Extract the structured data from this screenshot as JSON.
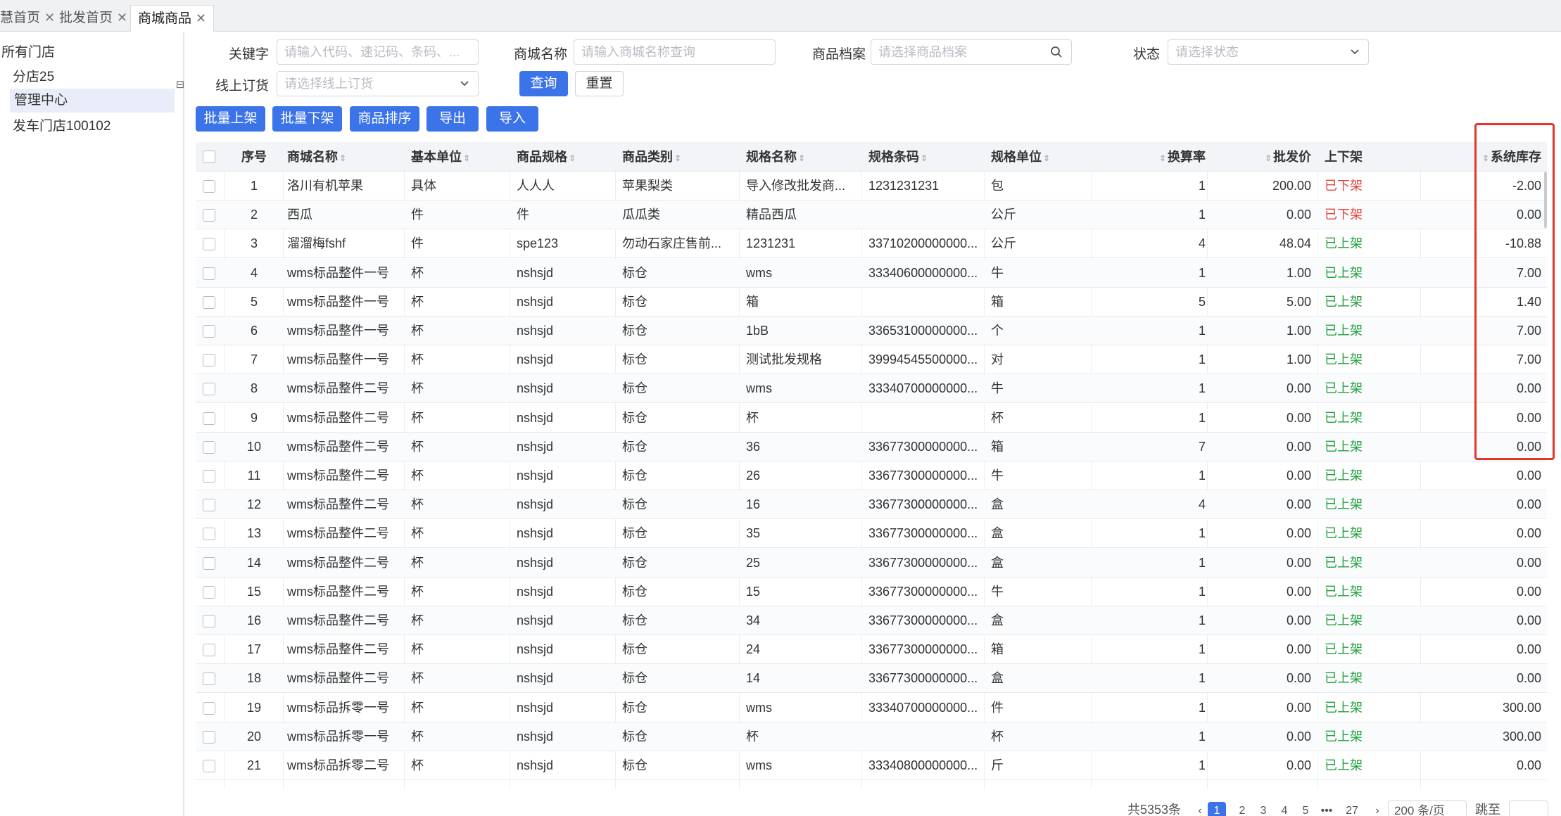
{
  "tabs": [
    {
      "label": "慧首页",
      "active": false
    },
    {
      "label": "批发首页",
      "active": false
    },
    {
      "label": "商城商品",
      "active": true
    }
  ],
  "sidebar": {
    "collapse_glyph": "⊟",
    "items": [
      {
        "label": "所有门店",
        "selected": false
      },
      {
        "label": "分店25",
        "selected": false
      },
      {
        "label": "管理中心",
        "selected": true
      },
      {
        "label": "发车门店100102",
        "selected": false
      }
    ]
  },
  "filters": {
    "keyword": {
      "label": "关键字",
      "placeholder": "请输入代码、速记码、条码、..."
    },
    "mall_name": {
      "label": "商城名称",
      "placeholder": "请输入商城名称查询"
    },
    "archive": {
      "label": "商品档案",
      "placeholder": "请选择商品档案"
    },
    "status": {
      "label": "状态",
      "placeholder": "请选择状态"
    },
    "online_order": {
      "label": "线上订货",
      "placeholder": "请选择线上订货"
    },
    "query_label": "查询",
    "reset_label": "重置"
  },
  "toolbar": {
    "batch_on": "批量上架",
    "batch_off": "批量下架",
    "sort": "商品排序",
    "export": "导出",
    "import": "导入"
  },
  "table": {
    "columns": [
      "序号",
      "商城名称",
      "基本单位",
      "商品规格",
      "商品类别",
      "规格名称",
      "规格条码",
      "规格单位",
      "换算率",
      "批发价",
      "上下架",
      "系统库存"
    ],
    "rows": [
      [
        "1",
        "洛川有机苹果",
        "具体",
        "人人人",
        "苹果梨类",
        "导入修改批发商...",
        "1231231231",
        "包",
        "1",
        "200.00",
        "已下架",
        "-2.00"
      ],
      [
        "2",
        "西瓜",
        "件",
        "件",
        "瓜瓜类",
        "精品西瓜",
        "",
        "公斤",
        "1",
        "0.00",
        "已下架",
        "0.00"
      ],
      [
        "3",
        "溜溜梅fshf",
        "件",
        "spe123",
        "勿动石家庄售前...",
        "1231231",
        "33710200000000...",
        "公斤",
        "4",
        "48.04",
        "已上架",
        "-10.88"
      ],
      [
        "4",
        "wms标品整件一号",
        "杯",
        "nshsjd",
        "标仓",
        "wms",
        "33340600000000...",
        "牛",
        "1",
        "1.00",
        "已上架",
        "7.00"
      ],
      [
        "5",
        "wms标品整件一号",
        "杯",
        "nshsjd",
        "标仓",
        "箱",
        "",
        "箱",
        "5",
        "5.00",
        "已上架",
        "1.40"
      ],
      [
        "6",
        "wms标品整件一号",
        "杯",
        "nshsjd",
        "标仓",
        "1bB",
        "33653100000000...",
        "个",
        "1",
        "1.00",
        "已上架",
        "7.00"
      ],
      [
        "7",
        "wms标品整件一号",
        "杯",
        "nshsjd",
        "标仓",
        "测试批发规格",
        "39994545500000...",
        "对",
        "1",
        "1.00",
        "已上架",
        "7.00"
      ],
      [
        "8",
        "wms标品整件二号",
        "杯",
        "nshsjd",
        "标仓",
        "wms",
        "33340700000000...",
        "牛",
        "1",
        "0.00",
        "已上架",
        "0.00"
      ],
      [
        "9",
        "wms标品整件二号",
        "杯",
        "nshsjd",
        "标仓",
        "杯",
        "",
        "杯",
        "1",
        "0.00",
        "已上架",
        "0.00"
      ],
      [
        "10",
        "wms标品整件二号",
        "杯",
        "nshsjd",
        "标仓",
        "36",
        "33677300000000...",
        "箱",
        "7",
        "0.00",
        "已上架",
        "0.00"
      ],
      [
        "11",
        "wms标品整件二号",
        "杯",
        "nshsjd",
        "标仓",
        "26",
        "33677300000000...",
        "牛",
        "1",
        "0.00",
        "已上架",
        "0.00"
      ],
      [
        "12",
        "wms标品整件二号",
        "杯",
        "nshsjd",
        "标仓",
        "16",
        "33677300000000...",
        "盒",
        "4",
        "0.00",
        "已上架",
        "0.00"
      ],
      [
        "13",
        "wms标品整件二号",
        "杯",
        "nshsjd",
        "标仓",
        "35",
        "33677300000000...",
        "盒",
        "1",
        "0.00",
        "已上架",
        "0.00"
      ],
      [
        "14",
        "wms标品整件二号",
        "杯",
        "nshsjd",
        "标仓",
        "25",
        "33677300000000...",
        "盒",
        "1",
        "0.00",
        "已上架",
        "0.00"
      ],
      [
        "15",
        "wms标品整件二号",
        "杯",
        "nshsjd",
        "标仓",
        "15",
        "33677300000000...",
        "牛",
        "1",
        "0.00",
        "已上架",
        "0.00"
      ],
      [
        "16",
        "wms标品整件二号",
        "杯",
        "nshsjd",
        "标仓",
        "34",
        "33677300000000...",
        "盒",
        "1",
        "0.00",
        "已上架",
        "0.00"
      ],
      [
        "17",
        "wms标品整件二号",
        "杯",
        "nshsjd",
        "标仓",
        "24",
        "33677300000000...",
        "箱",
        "1",
        "0.00",
        "已上架",
        "0.00"
      ],
      [
        "18",
        "wms标品整件二号",
        "杯",
        "nshsjd",
        "标仓",
        "14",
        "33677300000000...",
        "盒",
        "1",
        "0.00",
        "已上架",
        "0.00"
      ],
      [
        "19",
        "wms标品拆零一号",
        "杯",
        "nshsjd",
        "标仓",
        "wms",
        "33340700000000...",
        "件",
        "1",
        "0.00",
        "已上架",
        "300.00"
      ],
      [
        "20",
        "wms标品拆零一号",
        "杯",
        "nshsjd",
        "标仓",
        "杯",
        "",
        "杯",
        "1",
        "0.00",
        "已上架",
        "300.00"
      ],
      [
        "21",
        "wms标品拆零二号",
        "杯",
        "nshsjd",
        "标仓",
        "wms",
        "33340800000000...",
        "斤",
        "1",
        "0.00",
        "已上架",
        "0.00"
      ]
    ]
  },
  "pagination": {
    "total": "共5353条",
    "prev": "‹",
    "pages": [
      "1",
      "2",
      "3",
      "4",
      "5",
      "•••",
      "27"
    ],
    "current": "1",
    "next": "›",
    "page_size": "200 条/页",
    "jump_label": "跳至"
  },
  "colors": {
    "primary": "#3b73e8",
    "off_shelf": "#e2443a",
    "on_shelf": "#21a03c",
    "highlight": "#e0362c"
  }
}
